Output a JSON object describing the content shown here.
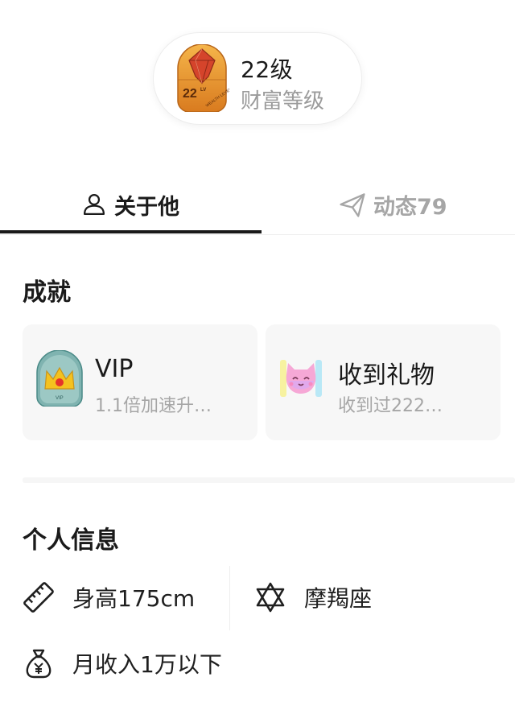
{
  "wealth": {
    "badge_text": "22",
    "badge_sup": "LV",
    "badge_caption": "WEALTH LEVEL",
    "level": "22级",
    "label": "财富等级"
  },
  "tabs": [
    {
      "label": "关于他",
      "icon": "person-icon",
      "active": true
    },
    {
      "label": "动态79",
      "icon": "send-icon",
      "active": false
    }
  ],
  "achievements": {
    "title": "成就",
    "items": [
      {
        "title": "VIP",
        "desc": "1.1倍加速升…",
        "icon": "vip-crown-icon",
        "icon_caption": "VIP"
      },
      {
        "title": "收到礼物",
        "desc": "收到过222…",
        "icon": "gift-cat-icon"
      }
    ]
  },
  "personal_info": {
    "title": "个人信息",
    "height": {
      "text": "身高175cm",
      "icon": "ruler-icon"
    },
    "zodiac": {
      "text": "摩羯座",
      "icon": "star-of-david-icon"
    },
    "income": {
      "text": "月收入1万以下",
      "icon": "money-bag-icon"
    }
  },
  "colors": {
    "active_text": "#1a1a1a",
    "muted_text": "#a6a6a6",
    "card_bg": "#f7f7f7",
    "badge_gold": "#e8a13a",
    "badge_red": "#d5442b",
    "vip_teal": "#5f9ea0"
  }
}
